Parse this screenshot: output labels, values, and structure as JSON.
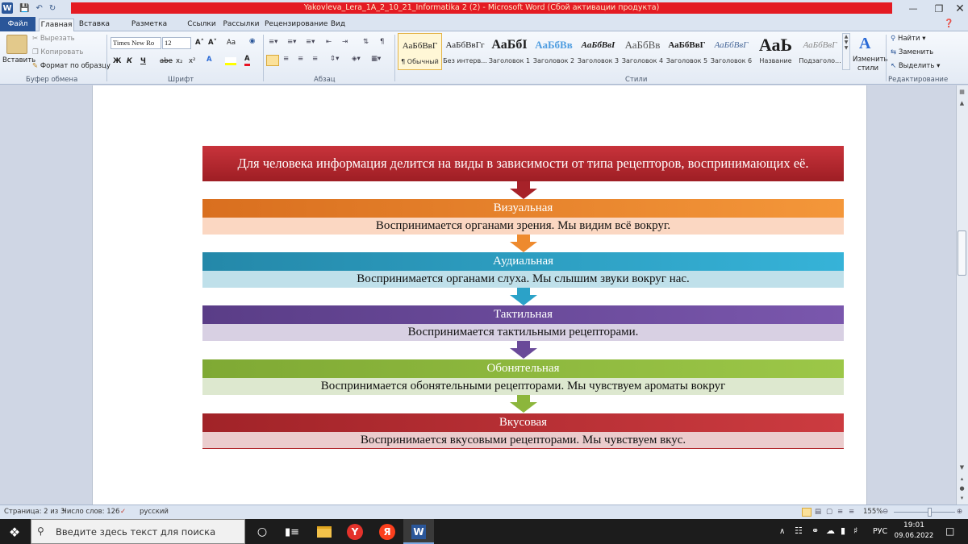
{
  "window": {
    "title": "Yakovleva_Lera_1A_2_10_21_Informatika 2 (2)  -  Microsoft Word (Сбой активации продукта)",
    "app_icon": "W"
  },
  "tabs": [
    {
      "label": "Файл"
    },
    {
      "label": "Главная"
    },
    {
      "label": "Вставка"
    },
    {
      "label": "Разметка страницы"
    },
    {
      "label": "Ссылки"
    },
    {
      "label": "Рассылки"
    },
    {
      "label": "Рецензирование"
    },
    {
      "label": "Вид"
    }
  ],
  "ribbon": {
    "clipboard": {
      "paste": "Вставить",
      "cut": "Вырезать",
      "copy": "Копировать",
      "format_painter": "Формат по образцу",
      "group": "Буфер обмена"
    },
    "font": {
      "font_name": "Times New Ro",
      "font_size": "12",
      "group": "Шрифт",
      "bold": "Ж",
      "italic": "К",
      "underline": "Ч",
      "strike": "abe",
      "subscript": "x₂",
      "superscript": "x²",
      "grow": "A˄",
      "shrink": "A˅",
      "case": "Aa",
      "highlight_color": "#ffff00",
      "font_color": "#e81123"
    },
    "paragraph": {
      "group": "Абзац"
    },
    "styles": {
      "group": "Стили",
      "tiles": [
        {
          "sample": "АаБбВвГ",
          "name": "¶ Обычный"
        },
        {
          "sample": "АаБбВвГг",
          "name": "Без интерв..."
        },
        {
          "sample": "АаБбІ",
          "name": "Заголовок 1"
        },
        {
          "sample": "АаБбВв",
          "name": "Заголовок 2"
        },
        {
          "sample": "АаБбВвІ",
          "name": "Заголовок 3"
        },
        {
          "sample": "АаБбВв",
          "name": "Заголовок 4"
        },
        {
          "sample": "АаБбВвГ",
          "name": "Заголовок 5"
        },
        {
          "sample": "АаБбВвГ",
          "name": "Заголовок 6"
        },
        {
          "sample": "АаЬ",
          "name": "Название"
        },
        {
          "sample": "АаБбВвГ",
          "name": "Подзаголо..."
        }
      ],
      "change_styles": "Изменить стили"
    },
    "editing": {
      "find": "Найти",
      "replace": "Заменить",
      "select": "Выделить",
      "group": "Редактирование"
    }
  },
  "document": {
    "header": "Для человека информация делится на виды в зависимости от типа рецепторов, воспринимающих её.",
    "items": [
      {
        "title": "Визуальная",
        "desc": "Воспринимается органами зрения. Мы видим всё вокруг.",
        "color": "#e8822a",
        "light": "#fbd7c2"
      },
      {
        "title": "Аудиальная",
        "desc": "Воспринимается органами слуха. Мы слышим звуки вокруг нас.",
        "color": "#2b9fc4",
        "light": "#bfe0ea"
      },
      {
        "title": "Тактильная",
        "desc": "Воспринимается тактильными рецепторами.",
        "color": "#6a4a99",
        "light": "#d8d0e3"
      },
      {
        "title": "Обонятельная",
        "desc": "Воспринимается обонятельными рецепторами. Мы чувствуем ароматы вокруг",
        "color": "#8cb63c",
        "light": "#dde8cf"
      },
      {
        "title": "Вкусовая",
        "desc": "Воспринимается вкусовыми рецепторами. Мы чувствуем вкус.",
        "color": "#b22a2f",
        "light": "#ebcccd"
      }
    ]
  },
  "statusbar": {
    "page": "Страница: 2 из 3",
    "words": "Число слов: 126",
    "language": "русский",
    "zoom": "155%"
  },
  "taskbar": {
    "search_placeholder": "Введите здесь текст для поиска",
    "lang": "РУС",
    "time": "19:01",
    "date": "09.06.2022"
  }
}
